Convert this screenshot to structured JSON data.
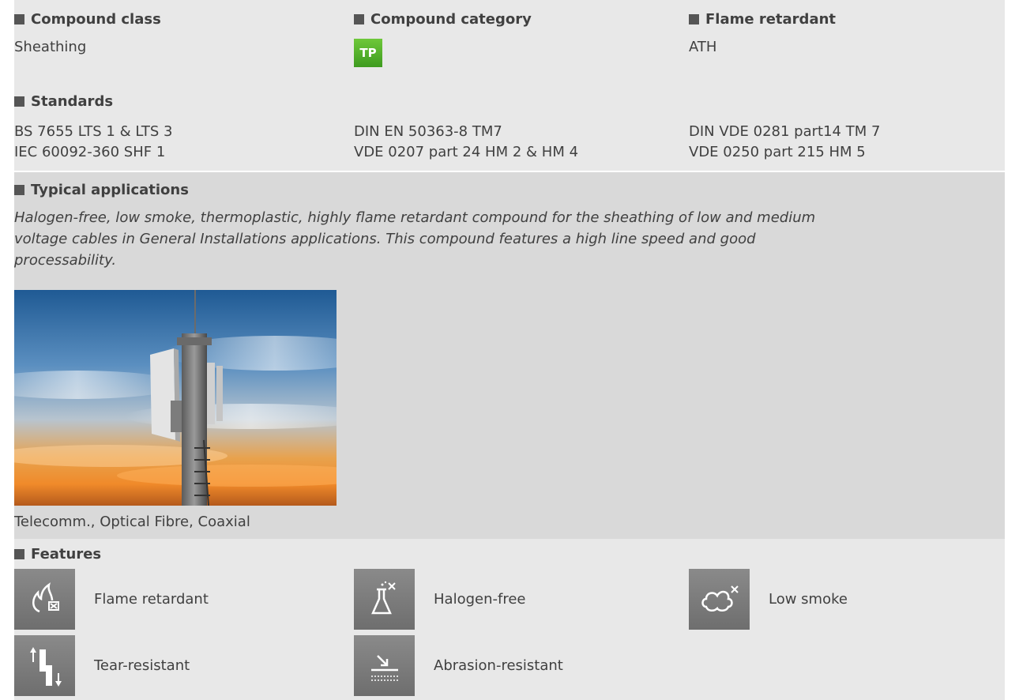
{
  "row1": {
    "compound_class": {
      "label": "Compound class",
      "value": "Sheathing"
    },
    "compound_category": {
      "label": "Compound category",
      "badge": "TP"
    },
    "flame_retardant": {
      "label": "Flame retardant",
      "value": "ATH"
    }
  },
  "standards": {
    "label": "Standards",
    "col1": [
      "BS 7655 LTS 1 & LTS 3",
      "IEC 60092-360 SHF 1"
    ],
    "col2": [
      "DIN EN 50363-8 TM7",
      "VDE 0207 part 24 HM 2 & HM 4"
    ],
    "col3": [
      "DIN VDE 0281 part14 TM 7",
      "VDE 0250 part 215 HM 5"
    ]
  },
  "applications": {
    "label": "Typical applications",
    "description_lines": [
      "Halogen-free, low smoke, thermoplastic, highly flame retardant compound for the sheathing of low and medium",
      "voltage cables in General Installations applications. This compound features a high line speed and good",
      "processability."
    ],
    "image_caption": "Telecomm., Optical Fibre, Coaxial"
  },
  "features": {
    "label": "Features",
    "items": [
      {
        "label": "Flame retardant",
        "icon": "flame-retardant-icon"
      },
      {
        "label": "Halogen-free",
        "icon": "halogen-free-icon"
      },
      {
        "label": "Low smoke",
        "icon": "low-smoke-icon"
      },
      {
        "label": "Tear-resistant",
        "icon": "tear-resistant-icon"
      },
      {
        "label": "Abrasion-resistant",
        "icon": "abrasion-resistant-icon"
      }
    ]
  },
  "colors": {
    "header_bg": "#e8e8e8",
    "section_bg": "#d9d9d9",
    "badge_green": "#4aa52a",
    "icon_grey": "#7a7a7a"
  }
}
